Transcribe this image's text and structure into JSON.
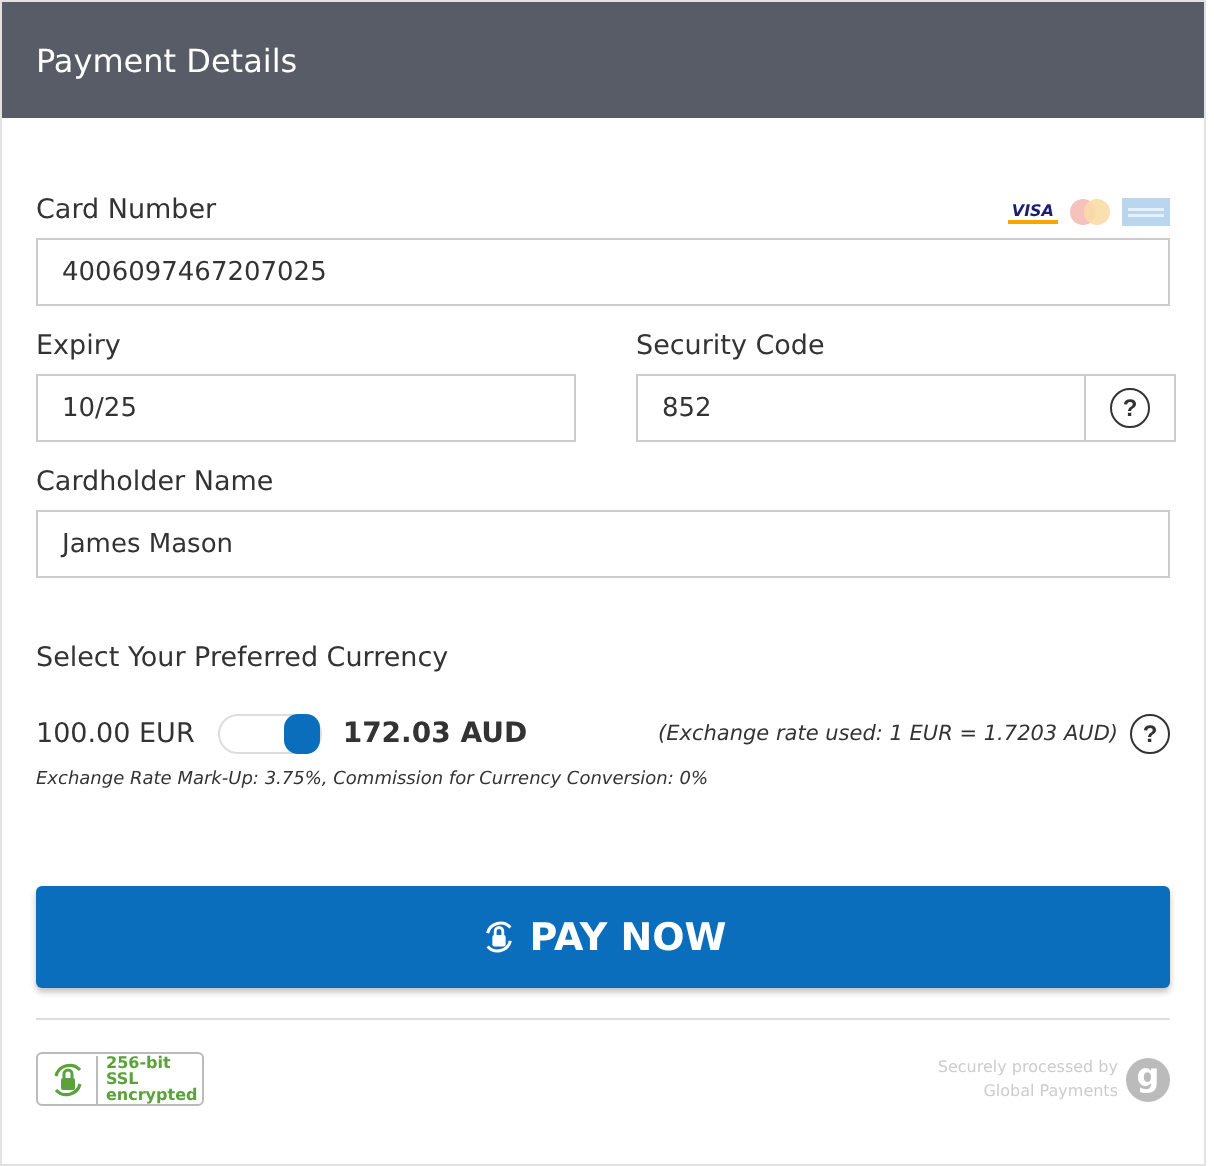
{
  "header": {
    "title": "Payment Details"
  },
  "card_number": {
    "label": "Card Number",
    "value": "4006097467207025",
    "brands": [
      {
        "kind": "visa",
        "text": "VISA"
      },
      {
        "kind": "mastercard"
      },
      {
        "kind": "amex"
      }
    ]
  },
  "expiry": {
    "label": "Expiry",
    "value": "10/25"
  },
  "security_code": {
    "label": "Security Code",
    "value": "852",
    "help": "?"
  },
  "cardholder": {
    "label": "Cardholder Name",
    "value": "James Mason"
  },
  "currency": {
    "title": "Select Your Preferred Currency",
    "from": "100.00 EUR",
    "on": true,
    "to": "172.03 AUD",
    "rate": "(Exchange rate used: 1 EUR = 1.7203 AUD)",
    "help": "?",
    "note": "Exchange Rate Mark-Up: 3.75%, Commission for Currency Conversion: 0%"
  },
  "pay_button": {
    "label": "PAY NOW"
  },
  "footer": {
    "ssl": "256-bit SSL encrypted",
    "processed_by": "Securely processed by",
    "processor": "Global Payments",
    "logo_letter": "g"
  }
}
